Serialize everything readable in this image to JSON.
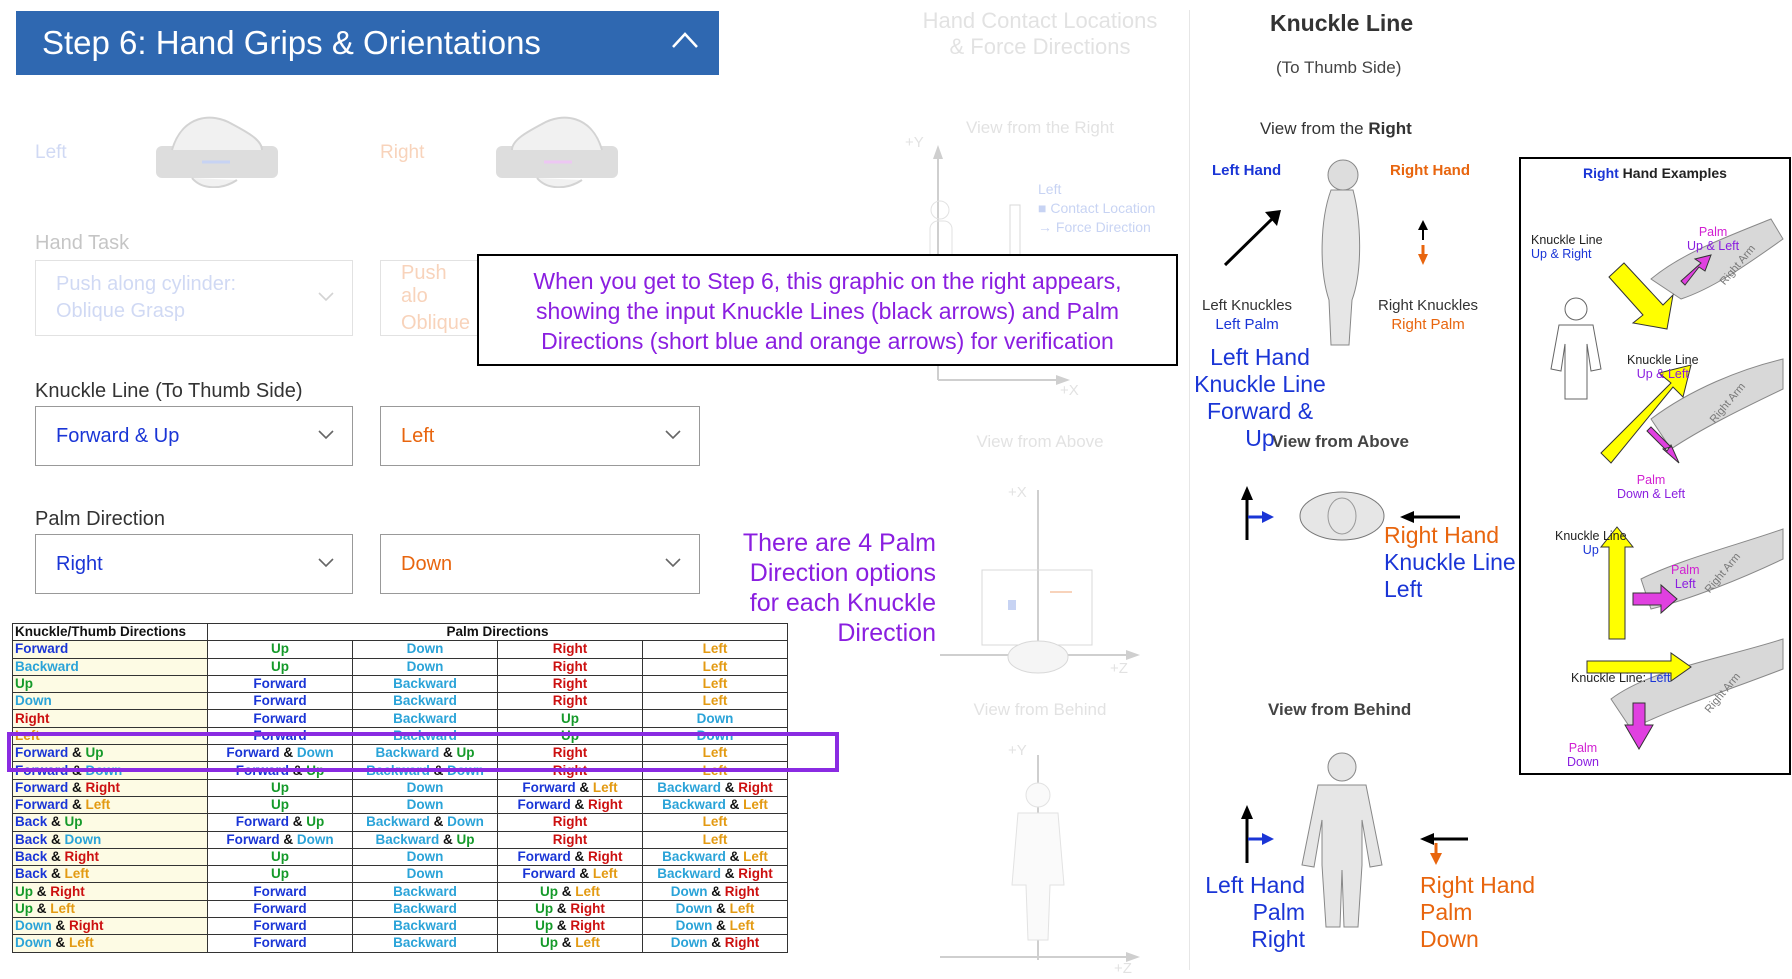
{
  "step_header": {
    "title": "Step 6: Hand Grips & Orientations"
  },
  "grip_labels": {
    "left": "Left",
    "right": "Right"
  },
  "hand_task": {
    "label": "Hand Task",
    "left_value_line1": "Push along cylinder:",
    "left_value_line2": "Oblique Grasp",
    "right_value_line1": "Push alo",
    "right_value_line2": "Oblique"
  },
  "knuckle_line": {
    "label": "Knuckle Line (To Thumb Side)",
    "left_value": "Forward & Up",
    "right_value": "Left"
  },
  "palm_direction": {
    "label": "Palm Direction",
    "left_value": "Right",
    "right_value": "Down"
  },
  "callout": {
    "line1": "When you get to Step 6, this graphic on the right appears,",
    "line2": "showing the input Knuckle Lines (black arrows) and Palm",
    "line3": "Directions (short blue and orange arrows) for verification"
  },
  "palm_note": {
    "line1": "There are 4 Palm",
    "line2": "Direction options",
    "line3": "for each Knuckle",
    "line4": "Direction"
  },
  "center_panel": {
    "title_line1": "Hand Contact Locations",
    "title_line2": "& Force Directions",
    "view_right": "View from the Right",
    "view_above": "View from Above",
    "view_behind": "View from Behind",
    "legend_title": "Left",
    "legend_contact": "Contact Location",
    "legend_force": "Force Direction",
    "axis_y": "+Y",
    "axis_x": "+X",
    "axis_z": "+Z"
  },
  "right_panel": {
    "title": "Knuckle Line",
    "subtitle": "(To Thumb Side)",
    "view_right_prefix": "View from the ",
    "view_right_word": "Right",
    "left_hand": "Left Hand",
    "right_hand": "Right Hand",
    "left_knuckles": "Left Knuckles",
    "left_palm": "Left Palm",
    "right_knuckles": "Right Knuckles",
    "right_palm": "Right Palm",
    "left_kl_line1": "Left Hand",
    "left_kl_line2": "Knuckle Line",
    "left_kl_line3": "Forward & Up",
    "view_above": "View from Above",
    "right_kl_line1": "Right Hand",
    "right_kl_line2": "Knuckle Line",
    "right_kl_line3": "Left",
    "view_behind": "View from Behind",
    "left_palm_line1": "Left Hand",
    "left_palm_line2": "Palm",
    "left_palm_line3": "Right",
    "right_palm_line1": "Right Hand",
    "right_palm_line2": "Palm",
    "right_palm_line3": "Down"
  },
  "examples": {
    "title_word": "Right",
    "title_rest": " Hand Examples",
    "e1_kl": "Knuckle Line",
    "e1_kl_dir": "Up & Right",
    "e1_palm": "Palm",
    "e1_palm_dir": "Up & Left",
    "e2_kl": "Knuckle Line",
    "e2_kl_dir": "Up & Left",
    "e2_palm": "Palm",
    "e2_palm_dir": "Down & Left",
    "e3_kl": "Knuckle Line",
    "e3_kl_dir": "Up",
    "e3_palm": "Palm",
    "e3_palm_dir": "Left",
    "e4_kl": "Knuckle Line: ",
    "e4_kl_dir": "Left",
    "e4_palm": "Palm",
    "e4_palm_dir": "Down",
    "arm_label": "Right Arm"
  },
  "table": {
    "header_knuckle": "Knuckle/Thumb Directions",
    "header_palm": "Palm Directions",
    "rows": [
      [
        [
          "Forward",
          "b"
        ]
      ],
      [
        [
          "Up",
          "g"
        ]
      ],
      [
        [
          "Down",
          "c"
        ]
      ],
      [
        [
          "Right",
          "r"
        ]
      ],
      [
        [
          "Left",
          "o"
        ]
      ],
      [
        [
          "Backward",
          "c"
        ]
      ],
      [
        [
          "Up",
          "g"
        ]
      ],
      [
        [
          "Down",
          "c"
        ]
      ],
      [
        [
          "Right",
          "r"
        ]
      ],
      [
        [
          "Left",
          "o"
        ]
      ],
      [
        [
          "Up",
          "g"
        ]
      ],
      [
        [
          "Forward",
          "b"
        ]
      ],
      [
        [
          "Backward",
          "c"
        ]
      ],
      [
        [
          "Right",
          "r"
        ]
      ],
      [
        [
          "Left",
          "o"
        ]
      ],
      [
        [
          "Down",
          "c"
        ]
      ],
      [
        [
          "Forward",
          "b"
        ]
      ],
      [
        [
          "Backward",
          "c"
        ]
      ],
      [
        [
          "Right",
          "r"
        ]
      ],
      [
        [
          "Left",
          "o"
        ]
      ]
    ],
    "grid": [
      [
        [
          [
            "Forward",
            "b"
          ]
        ],
        [
          [
            "Up",
            "g"
          ]
        ],
        [
          [
            "Down",
            "c"
          ]
        ],
        [
          [
            "Right",
            "r"
          ]
        ],
        [
          [
            "Left",
            "o"
          ]
        ]
      ],
      [
        [
          [
            "Backward",
            "c"
          ]
        ],
        [
          [
            "Up",
            "g"
          ]
        ],
        [
          [
            "Down",
            "c"
          ]
        ],
        [
          [
            "Right",
            "r"
          ]
        ],
        [
          [
            "Left",
            "o"
          ]
        ]
      ],
      [
        [
          [
            "Up",
            "g"
          ]
        ],
        [
          [
            "Forward",
            "b"
          ]
        ],
        [
          [
            "Backward",
            "c"
          ]
        ],
        [
          [
            "Right",
            "r"
          ]
        ],
        [
          [
            "Left",
            "o"
          ]
        ]
      ],
      [
        [
          [
            "Down",
            "c"
          ]
        ],
        [
          [
            "Forward",
            "b"
          ]
        ],
        [
          [
            "Backward",
            "c"
          ]
        ],
        [
          [
            "Right",
            "r"
          ]
        ],
        [
          [
            "Left",
            "o"
          ]
        ]
      ],
      [
        [
          [
            "Right",
            "r"
          ]
        ],
        [
          [
            "Forward",
            "b"
          ]
        ],
        [
          [
            "Backward",
            "c"
          ]
        ],
        [
          [
            "Up",
            "g"
          ]
        ],
        [
          [
            "Down",
            "c"
          ]
        ]
      ],
      [
        [
          [
            "Left",
            "o"
          ]
        ],
        [
          [
            "Forward",
            "b"
          ]
        ],
        [
          [
            "Backward",
            "c"
          ]
        ],
        [
          [
            "Up",
            "g"
          ]
        ],
        [
          [
            "Down",
            "c"
          ]
        ]
      ],
      [
        [
          [
            "Forward",
            "b"
          ],
          [
            " & ",
            "k"
          ],
          [
            "Up",
            "g"
          ]
        ],
        [
          [
            "Forward",
            "b"
          ],
          [
            " & ",
            "k"
          ],
          [
            "Down",
            "c"
          ]
        ],
        [
          [
            "Backward",
            "c"
          ],
          [
            " & ",
            "k"
          ],
          [
            "Up",
            "g"
          ]
        ],
        [
          [
            "Right",
            "r"
          ]
        ],
        [
          [
            "Left",
            "o"
          ]
        ]
      ],
      [
        [
          [
            "Forward",
            "b"
          ],
          [
            " & ",
            "k"
          ],
          [
            "Down",
            "c"
          ]
        ],
        [
          [
            "Forward",
            "b"
          ],
          [
            " & ",
            "k"
          ],
          [
            "Up",
            "g"
          ]
        ],
        [
          [
            "Backward",
            "c"
          ],
          [
            " & ",
            "k"
          ],
          [
            "Down",
            "c"
          ]
        ],
        [
          [
            "Right",
            "r"
          ]
        ],
        [
          [
            "Left",
            "o"
          ]
        ]
      ],
      [
        [
          [
            "Forward",
            "b"
          ],
          [
            " & ",
            "k"
          ],
          [
            "Right",
            "r"
          ]
        ],
        [
          [
            "Up",
            "g"
          ]
        ],
        [
          [
            "Down",
            "c"
          ]
        ],
        [
          [
            "Forward",
            "b"
          ],
          [
            " & ",
            "k"
          ],
          [
            "Left",
            "o"
          ]
        ],
        [
          [
            "Backward",
            "c"
          ],
          [
            " & ",
            "k"
          ],
          [
            "Right",
            "r"
          ]
        ]
      ],
      [
        [
          [
            "Forward",
            "b"
          ],
          [
            " & ",
            "k"
          ],
          [
            "Left",
            "o"
          ]
        ],
        [
          [
            "Up",
            "g"
          ]
        ],
        [
          [
            "Down",
            "c"
          ]
        ],
        [
          [
            "Forward",
            "b"
          ],
          [
            " & ",
            "k"
          ],
          [
            "Right",
            "r"
          ]
        ],
        [
          [
            "Backward",
            "c"
          ],
          [
            " & ",
            "k"
          ],
          [
            "Left",
            "o"
          ]
        ]
      ],
      [
        [
          [
            "Back",
            "b"
          ],
          [
            " & ",
            "k"
          ],
          [
            "Up",
            "g"
          ]
        ],
        [
          [
            "Forward",
            "b"
          ],
          [
            " & ",
            "k"
          ],
          [
            "Up",
            "g"
          ]
        ],
        [
          [
            "Backward",
            "c"
          ],
          [
            " & ",
            "k"
          ],
          [
            "Down",
            "c"
          ]
        ],
        [
          [
            "Right",
            "r"
          ]
        ],
        [
          [
            "Left",
            "o"
          ]
        ]
      ],
      [
        [
          [
            "Back",
            "b"
          ],
          [
            " & ",
            "k"
          ],
          [
            "Down",
            "c"
          ]
        ],
        [
          [
            "Forward",
            "b"
          ],
          [
            " & ",
            "k"
          ],
          [
            "Down",
            "c"
          ]
        ],
        [
          [
            "Backward",
            "c"
          ],
          [
            " & ",
            "k"
          ],
          [
            "Up",
            "g"
          ]
        ],
        [
          [
            "Right",
            "r"
          ]
        ],
        [
          [
            "Left",
            "o"
          ]
        ]
      ],
      [
        [
          [
            "Back",
            "b"
          ],
          [
            " & ",
            "k"
          ],
          [
            "Right",
            "r"
          ]
        ],
        [
          [
            "Up",
            "g"
          ]
        ],
        [
          [
            "Down",
            "c"
          ]
        ],
        [
          [
            "Forward",
            "b"
          ],
          [
            " & ",
            "k"
          ],
          [
            "Right",
            "r"
          ]
        ],
        [
          [
            "Backward",
            "c"
          ],
          [
            " & ",
            "k"
          ],
          [
            "Left",
            "o"
          ]
        ]
      ],
      [
        [
          [
            "Back",
            "b"
          ],
          [
            " & ",
            "k"
          ],
          [
            "Left",
            "o"
          ]
        ],
        [
          [
            "Up",
            "g"
          ]
        ],
        [
          [
            "Down",
            "c"
          ]
        ],
        [
          [
            "Forward",
            "b"
          ],
          [
            " & ",
            "k"
          ],
          [
            "Left",
            "o"
          ]
        ],
        [
          [
            "Backward",
            "c"
          ],
          [
            " & ",
            "k"
          ],
          [
            "Right",
            "r"
          ]
        ]
      ],
      [
        [
          [
            "Up",
            "g"
          ],
          [
            " & ",
            "k"
          ],
          [
            "Right",
            "r"
          ]
        ],
        [
          [
            "Forward",
            "b"
          ]
        ],
        [
          [
            "Backward",
            "c"
          ]
        ],
        [
          [
            "Up",
            "g"
          ],
          [
            " & ",
            "k"
          ],
          [
            "Left",
            "o"
          ]
        ],
        [
          [
            "Down",
            "c"
          ],
          [
            " & ",
            "k"
          ],
          [
            "Right",
            "r"
          ]
        ]
      ],
      [
        [
          [
            "Up",
            "g"
          ],
          [
            " & ",
            "k"
          ],
          [
            "Left",
            "o"
          ]
        ],
        [
          [
            "Forward",
            "b"
          ]
        ],
        [
          [
            "Backward",
            "c"
          ]
        ],
        [
          [
            "Up",
            "g"
          ],
          [
            " & ",
            "k"
          ],
          [
            "Right",
            "r"
          ]
        ],
        [
          [
            "Down",
            "c"
          ],
          [
            " & ",
            "k"
          ],
          [
            "Left",
            "o"
          ]
        ]
      ],
      [
        [
          [
            "Down",
            "c"
          ],
          [
            " & ",
            "k"
          ],
          [
            "Right",
            "r"
          ]
        ],
        [
          [
            "Forward",
            "b"
          ]
        ],
        [
          [
            "Backward",
            "c"
          ]
        ],
        [
          [
            "Up",
            "g"
          ],
          [
            " & ",
            "k"
          ],
          [
            "Right",
            "r"
          ]
        ],
        [
          [
            "Down",
            "c"
          ],
          [
            " & ",
            "k"
          ],
          [
            "Left",
            "o"
          ]
        ]
      ],
      [
        [
          [
            "Down",
            "c"
          ],
          [
            " & ",
            "k"
          ],
          [
            "Left",
            "o"
          ]
        ],
        [
          [
            "Forward",
            "b"
          ]
        ],
        [
          [
            "Backward",
            "c"
          ]
        ],
        [
          [
            "Up",
            "g"
          ],
          [
            " & ",
            "k"
          ],
          [
            "Left",
            "o"
          ]
        ],
        [
          [
            "Down",
            "c"
          ],
          [
            " & ",
            "k"
          ],
          [
            "Right",
            "r"
          ]
        ]
      ]
    ]
  },
  "colors": {
    "b": "#1a35d6",
    "g": "#159a2a",
    "c": "#2aa3d8",
    "r": "#cc1010",
    "o": "#e39a12",
    "k": "#111111",
    "header": "#2f68b1",
    "highlight": "#8a2be2"
  }
}
